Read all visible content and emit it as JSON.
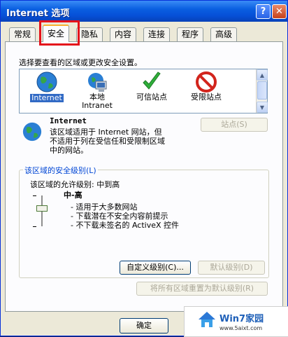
{
  "window": {
    "title": "Internet 选项",
    "help_label": "?",
    "close_label": "✕"
  },
  "tabs": [
    {
      "label": "常规"
    },
    {
      "label": "安全"
    },
    {
      "label": "隐私"
    },
    {
      "label": "内容"
    },
    {
      "label": "连接"
    },
    {
      "label": "程序"
    },
    {
      "label": "高级"
    }
  ],
  "security": {
    "select_zone_label": "选择要查看的区域或更改安全设置。",
    "zones": [
      {
        "label": "Internet",
        "icon": "globe-icon"
      },
      {
        "label": "本地 Intranet",
        "label_line1": "本地",
        "label_line2": "Intranet",
        "icon": "computer-icon"
      },
      {
        "label": "可信站点",
        "icon": "checkmark-icon"
      },
      {
        "label": "受限站点",
        "icon": "no-entry-icon"
      }
    ],
    "zone_info": {
      "title": "Internet",
      "line1": "该区域适用于 Internet 网站，但",
      "line2": "不适用于列在受信任和受限制区域",
      "line3": "中的网站。"
    },
    "sites_button": "站点(S)",
    "level_group_label": "该区域的安全级别(L)",
    "allowed_levels": "该区域的允许级别: 中到高",
    "level_name": "中-高",
    "level_points": [
      "- 适用于大多数网站",
      "- 下载潜在不安全内容前提示",
      "- 不下载未签名的 ActiveX 控件"
    ],
    "custom_level_button": "自定义级别(C)...",
    "default_level_button": "默认级别(D)",
    "reset_all_button": "将所有区域重置为默认级别(R)"
  },
  "footer": {
    "ok_button": "确定"
  },
  "watermark": {
    "brand": "Win7家园",
    "url": "www.5aixt.com"
  },
  "colors": {
    "title_bar": "#0a5fe0",
    "selection": "#316ac5",
    "highlight_box": "#e4121b"
  }
}
